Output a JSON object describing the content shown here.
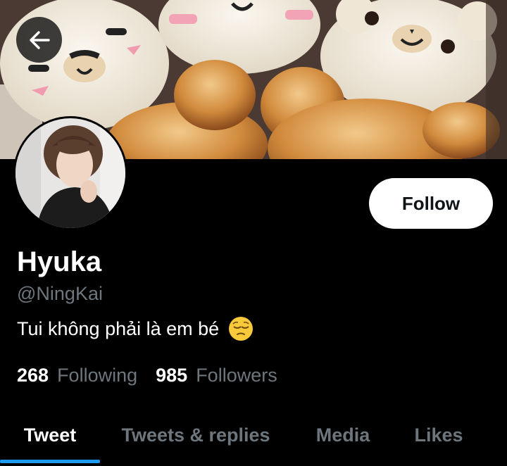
{
  "profile": {
    "display_name": "Hyuka",
    "handle": "@NingKai",
    "bio_text": "Tui không phải là em bé",
    "bio_emoji": "pensive-face-emoji"
  },
  "actions": {
    "follow_label": "Follow"
  },
  "stats": {
    "following_count": "268",
    "following_label": "Following",
    "followers_count": "985",
    "followers_label": "Followers"
  },
  "tabs": [
    {
      "label": "Tweet",
      "active": true
    },
    {
      "label": "Tweets & replies",
      "active": false
    },
    {
      "label": "Media",
      "active": false
    },
    {
      "label": "Likes",
      "active": false
    }
  ],
  "colors": {
    "background": "#000000",
    "accent": "#1d9bf0",
    "muted_text": "#6e767d",
    "follow_button_bg": "#ffffff"
  },
  "icons": {
    "back": "arrow-left-icon"
  }
}
